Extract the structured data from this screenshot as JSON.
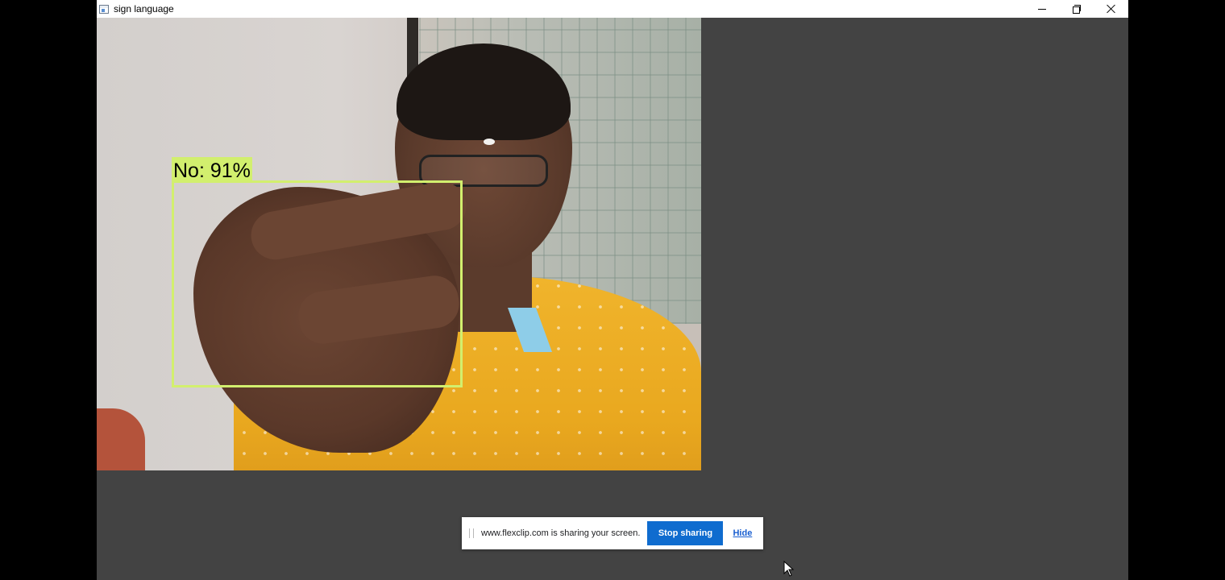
{
  "window": {
    "title": "sign language"
  },
  "detection": {
    "label": "No: 91%",
    "box_color": "#d2ef6e"
  },
  "share_bar": {
    "message": "www.flexclip.com is sharing your screen.",
    "stop_label": "Stop sharing",
    "hide_label": "Hide",
    "accent": "#0f6ccf"
  },
  "icons": {
    "minimize": "minimize-icon",
    "restore": "restore-icon",
    "close": "close-icon",
    "app": "app-window-icon",
    "cursor": "mouse-pointer-icon"
  }
}
